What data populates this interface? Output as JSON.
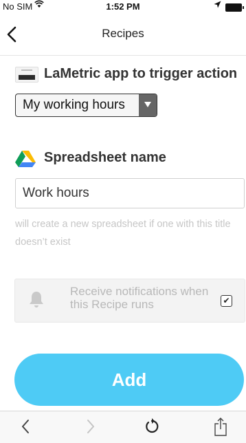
{
  "status_bar": {
    "carrier": "No SIM",
    "wifi_icon": "wifi-icon",
    "time": "1:52 PM",
    "location_icon": "location-arrow-icon",
    "battery_icon": "battery-icon"
  },
  "nav": {
    "back_icon": "chevron-left-icon",
    "back_glyph": "‹",
    "title": "Recipes"
  },
  "trigger": {
    "logo_icon": "lametric-logo-icon",
    "heading": "LaMetric app to trigger action",
    "select_value": "My working hours",
    "select_arrow_glyph": "▼"
  },
  "action": {
    "logo_icon": "google-drive-logo-icon",
    "heading": "Spreadsheet name",
    "input_value": "Work hours",
    "helper_text": "will create a new spreadsheet if one with this title doesn’t exist"
  },
  "notifications": {
    "bell_icon": "bell-icon",
    "label": "Receive notifications when this Recipe runs",
    "checked": true,
    "check_glyph": "✔"
  },
  "add_button_label": "Add",
  "toolbar": {
    "back_glyph": "‹",
    "forward_glyph": "›",
    "reload_glyph": "↻"
  },
  "colors": {
    "accent": "#4ecbf5",
    "select_arrow_bg": "#666666",
    "notify_bg": "#f3f3f3",
    "helper_text": "#c6c6c6"
  }
}
